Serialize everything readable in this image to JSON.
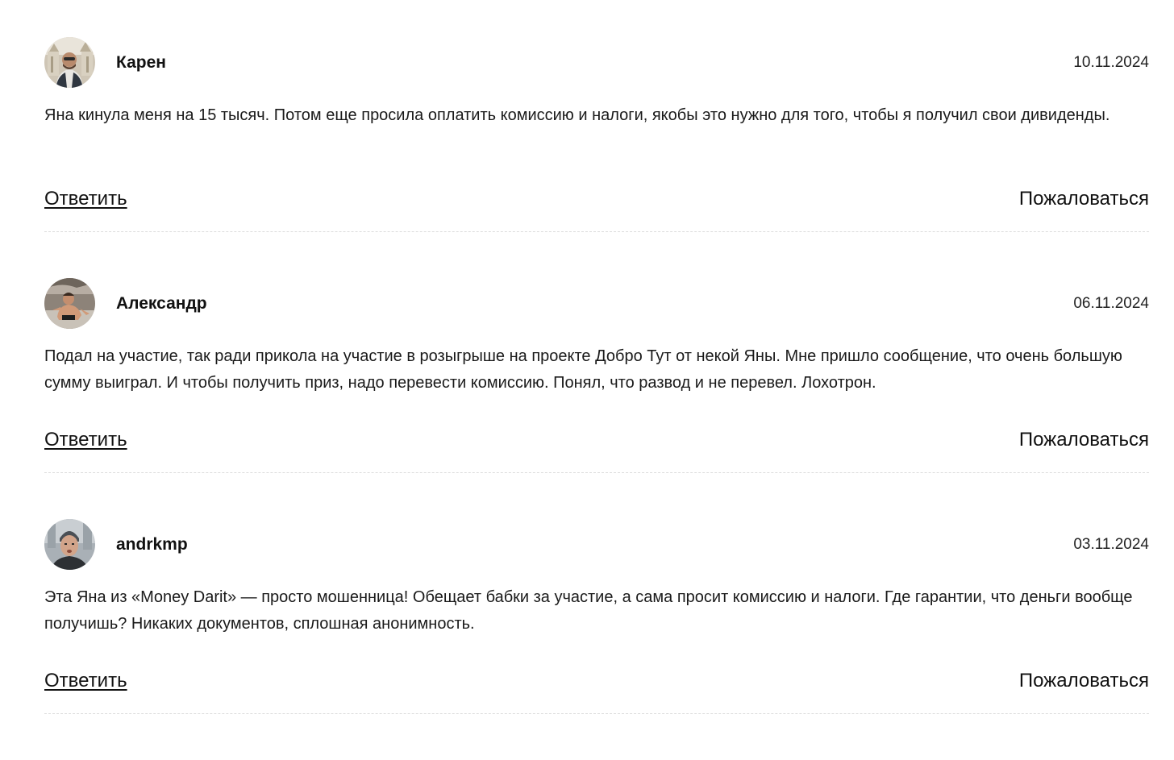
{
  "comments": [
    {
      "author": "Карен",
      "date": "10.11.2024",
      "text": "Яна кинула меня на 15 тысяч. Потом еще просила оплатить комиссию и налоги, якобы это нужно для того, чтобы я получил свои дивиденды.",
      "reply_label": "Ответить",
      "report_label": "Пожаловаться",
      "avatar_icon": "user-photo-avatar"
    },
    {
      "author": "Александр",
      "date": "06.11.2024",
      "text": "Подал на участие, так ради прикола на участие в розыгрыше на проекте Добро Тут от некой Яны. Мне пришло сообщение, что очень большую сумму выиграл. И чтобы получить приз, надо перевести комиссию. Понял, что развод и не перевел. Лохотрон.",
      "reply_label": "Ответить",
      "report_label": "Пожаловаться",
      "avatar_icon": "user-photo-avatar"
    },
    {
      "author": "andrkmp",
      "date": "03.11.2024",
      "text": "Эта Яна из «Money Darit» — просто мошенница! Обещает бабки за участие, а сама просит комиссию и налоги. Где гарантии, что деньги вообще получишь? Никаких документов, сплошная анонимность.",
      "reply_label": "Ответить",
      "report_label": "Пожаловаться",
      "avatar_icon": "user-photo-avatar"
    }
  ],
  "colors": {
    "text": "#111111",
    "divider": "#dcdcdc",
    "background": "#ffffff"
  }
}
